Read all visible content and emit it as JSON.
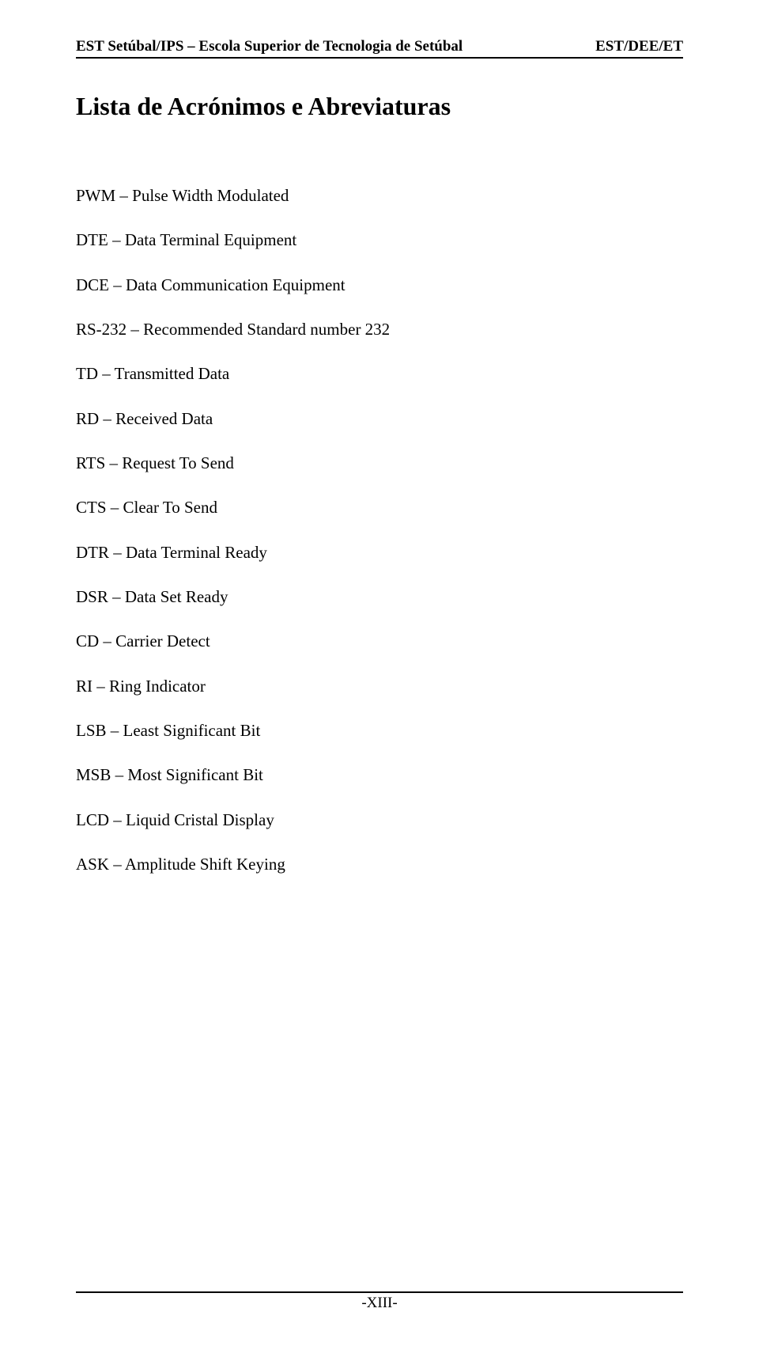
{
  "header": {
    "left": "EST Setúbal/IPS – Escola Superior de Tecnologia de Setúbal",
    "right": "EST/DEE/ET"
  },
  "title": "Lista de Acrónimos e Abreviaturas",
  "acronyms": [
    "PWM – Pulse Width Modulated",
    "DTE – Data Terminal Equipment",
    "DCE – Data Communication Equipment",
    "RS-232 – Recommended Standard number 232",
    "TD – Transmitted Data",
    "RD – Received Data",
    "RTS – Request To Send",
    "CTS – Clear To Send",
    "DTR – Data Terminal Ready",
    "DSR – Data Set Ready",
    "CD – Carrier Detect",
    "RI – Ring Indicator",
    "LSB – Least Significant Bit",
    "MSB – Most Significant Bit",
    "LCD – Liquid Cristal Display",
    "ASK – Amplitude Shift Keying"
  ],
  "footer": "-XIII-"
}
